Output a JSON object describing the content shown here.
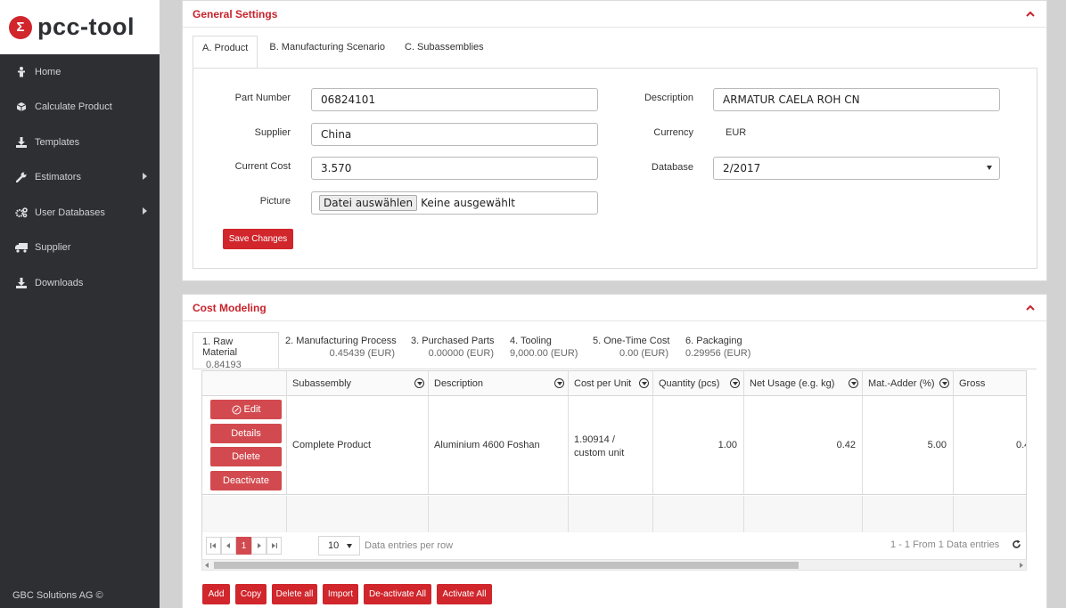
{
  "brand": {
    "name": "pcc-tool",
    "mark": "Σ"
  },
  "sidebar": {
    "items": [
      {
        "label": "Home",
        "icon": "home-icon"
      },
      {
        "label": "Calculate Product",
        "icon": "cube-icon"
      },
      {
        "label": "Templates",
        "icon": "download-icon"
      },
      {
        "label": "Estimators",
        "icon": "wrench-icon",
        "has_submenu": true
      },
      {
        "label": "User Databases",
        "icon": "cogs-icon",
        "has_submenu": true
      },
      {
        "label": "Supplier",
        "icon": "truck-icon"
      },
      {
        "label": "Downloads",
        "icon": "download-icon"
      }
    ],
    "footer": "GBC Solutions AG ©"
  },
  "general": {
    "title": "General Settings",
    "tabs": [
      "A. Product",
      "B. Manufacturing Scenario",
      "C. Subassemblies"
    ],
    "active_tab": 0,
    "part_number_label": "Part Number",
    "part_number_value": "06824101",
    "supplier_label": "Supplier",
    "supplier_value": "China",
    "current_cost_label": "Current Cost",
    "current_cost_value": "3.570",
    "picture_label": "Picture",
    "file_button": "Datei auswählen",
    "file_status": "Keine ausgewählt",
    "description_label": "Description",
    "description_value": "ARMATUR CAELA ROH CN",
    "currency_label": "Currency",
    "currency_value": "EUR",
    "database_label": "Database",
    "database_value": "2/2017",
    "save_button": "Save Changes"
  },
  "cost": {
    "title": "Cost Modeling",
    "tabs": [
      {
        "label": "1. Raw Material",
        "value": "0.84193 (EUR)"
      },
      {
        "label": "2. Manufacturing Process",
        "value": "0.45439 (EUR)"
      },
      {
        "label": "3. Purchased Parts",
        "value": "0.00000 (EUR)"
      },
      {
        "label": "4. Tooling",
        "value": "9,000.00 (EUR)"
      },
      {
        "label": "5. One-Time Cost",
        "value": "0.00 (EUR)"
      },
      {
        "label": "6. Packaging",
        "value": "0.29956 (EUR)"
      }
    ],
    "columns": [
      "Subassembly",
      "Description",
      "Cost per Unit",
      "Quantity (pcs)",
      "Net Usage (e.g. kg)",
      "Mat.-Adder (%)",
      "Gross"
    ],
    "row_actions": [
      "Edit",
      "Details",
      "Delete",
      "Deactivate"
    ],
    "row": {
      "subassembly": "Complete Product",
      "description": "Aluminium 4600 Foshan",
      "cost_per_unit": "1.90914 / custom unit",
      "quantity": "1.00",
      "net_usage": "0.42",
      "mat_adder": "5.00",
      "gross": "0.4"
    },
    "pager": {
      "current_page": "1",
      "page_size": "10",
      "page_size_label": "Data entries per row",
      "info": "1 - 1 From 1 Data entries"
    },
    "bottom_buttons": [
      "Add",
      "Copy",
      "Delete all",
      "Import",
      "De-activate All",
      "Activate All"
    ]
  },
  "colors": {
    "accent": "#c8232c",
    "button": "#d0262c",
    "sidebar": "#2d2f33"
  }
}
